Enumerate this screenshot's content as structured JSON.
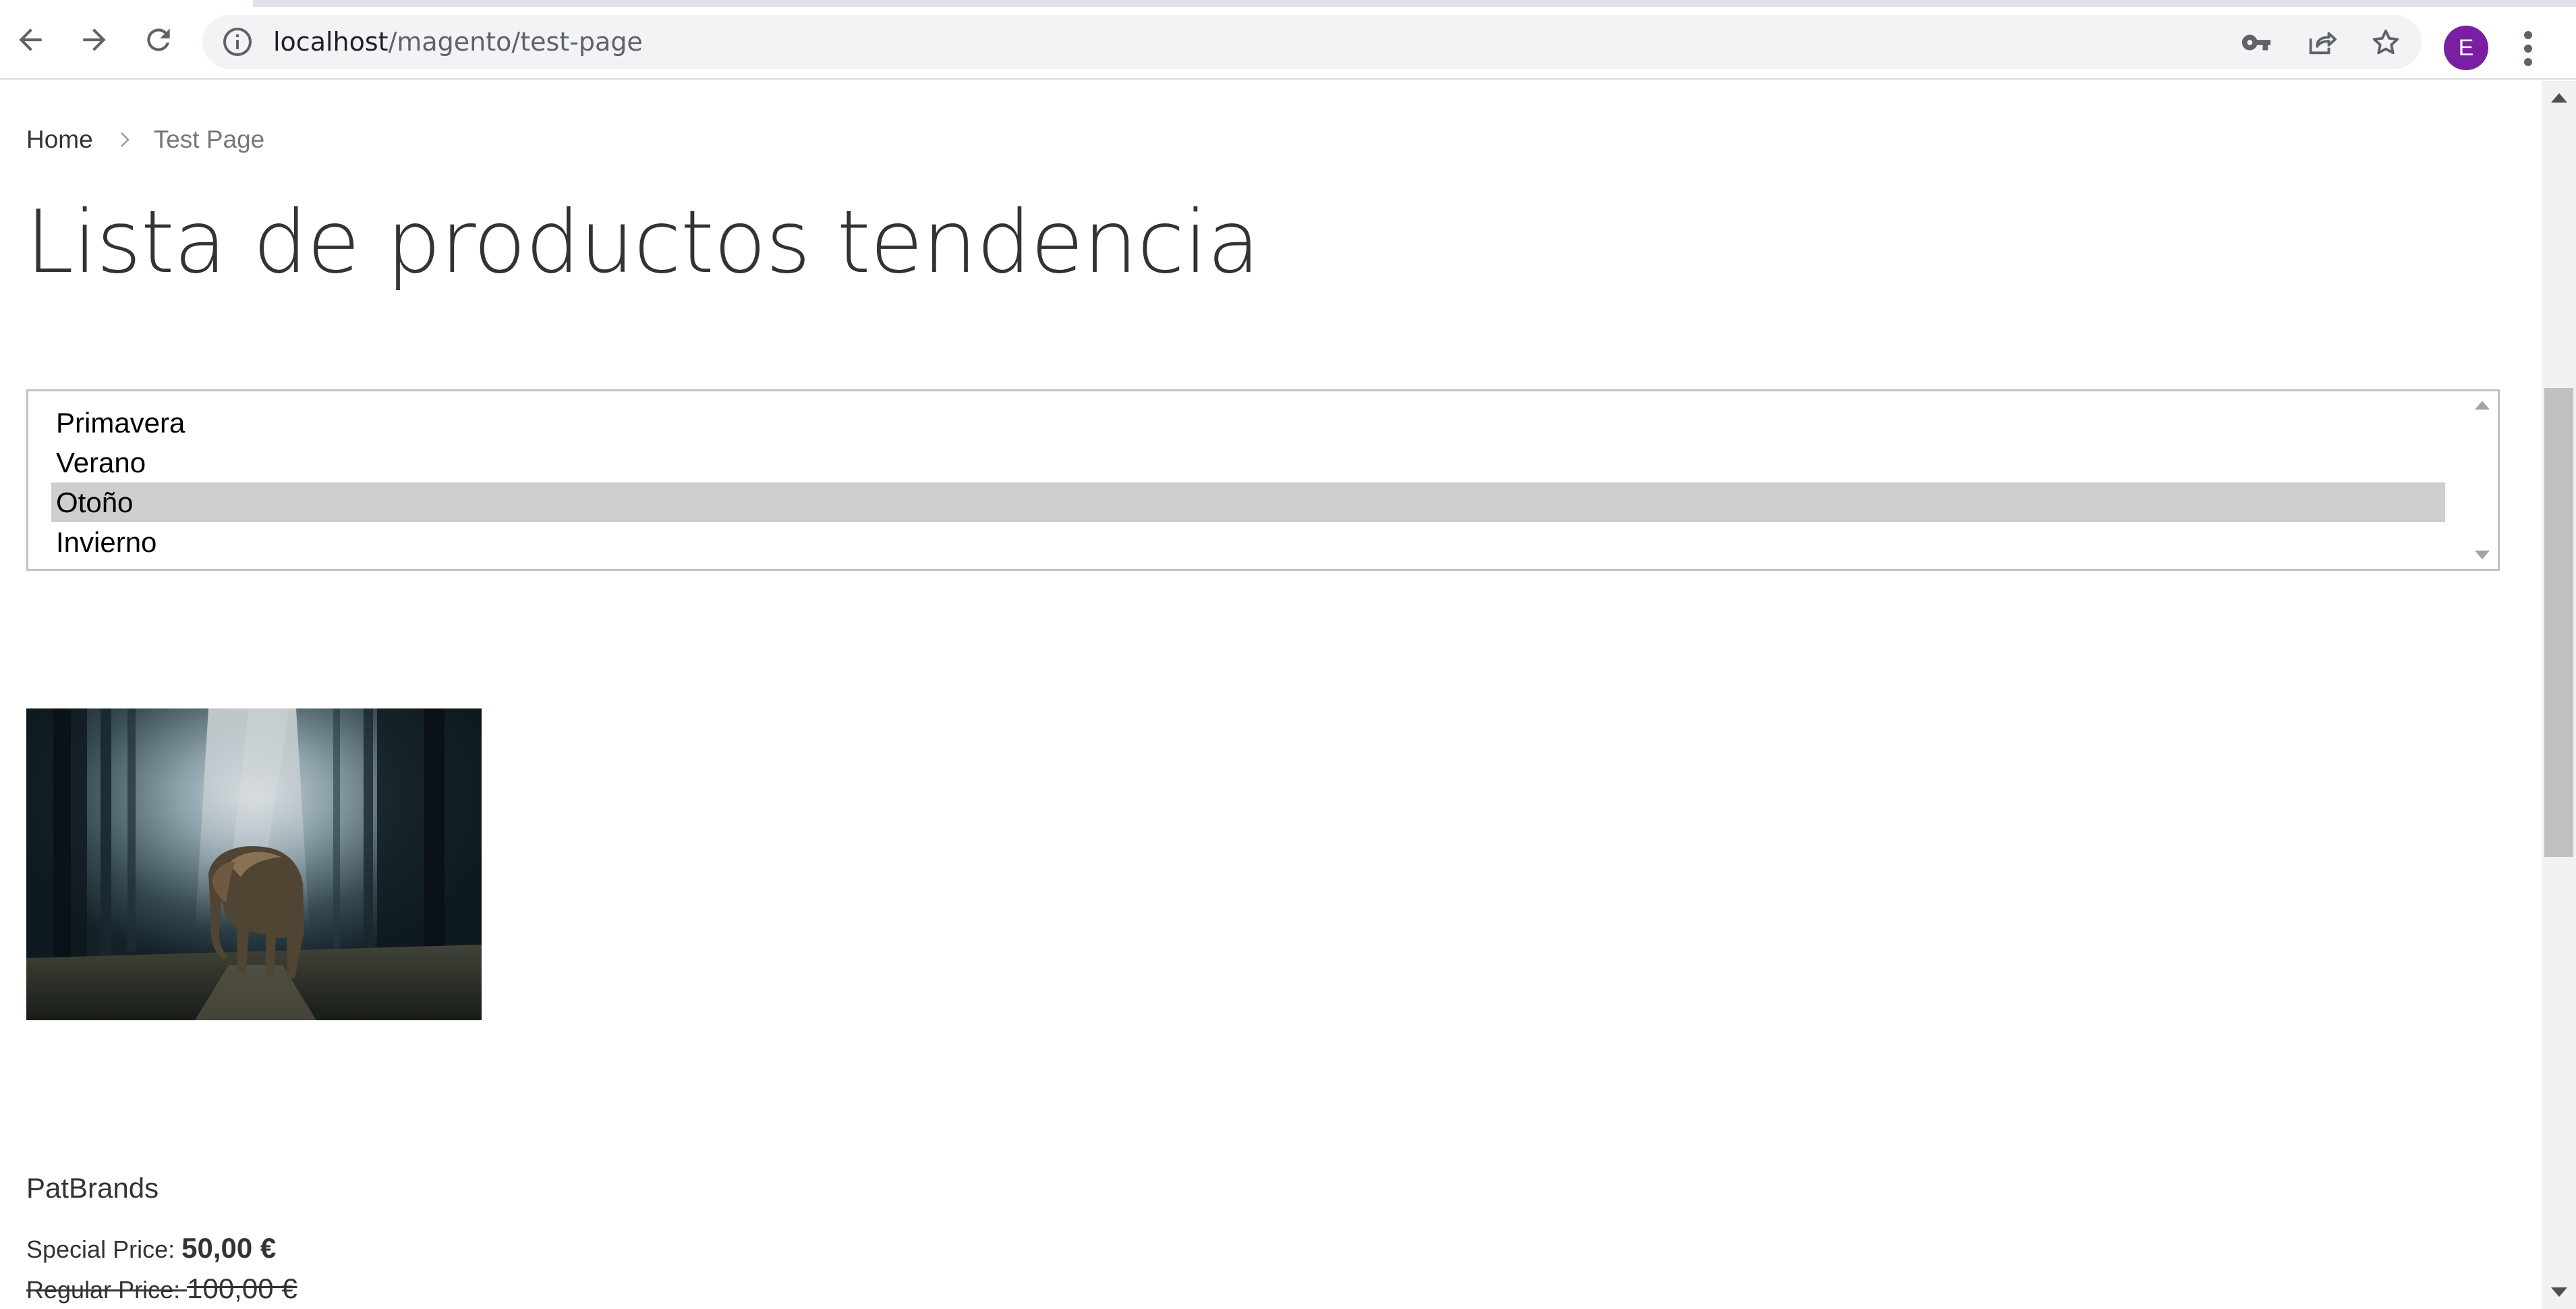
{
  "browser": {
    "url_host": "localhost",
    "url_path": "/magento/test-page",
    "profile_initial": "E",
    "colors": {
      "avatar": "#7b1fa2"
    }
  },
  "page": {
    "breadcrumb": {
      "home": "Home",
      "current": "Test Page"
    },
    "title": "Lista de productos tendencia",
    "season_list": {
      "options": [
        "Primavera",
        "Verano",
        "Otoño",
        "Invierno"
      ],
      "selected": "Otoño"
    },
    "product": {
      "image_alt": "elephant in a misty forest",
      "brand": "PatBrands",
      "special_price_label": "Special Price:",
      "special_price": "50,00 €",
      "regular_price_label": "Regular Price:",
      "regular_price": "100,00 €"
    }
  }
}
